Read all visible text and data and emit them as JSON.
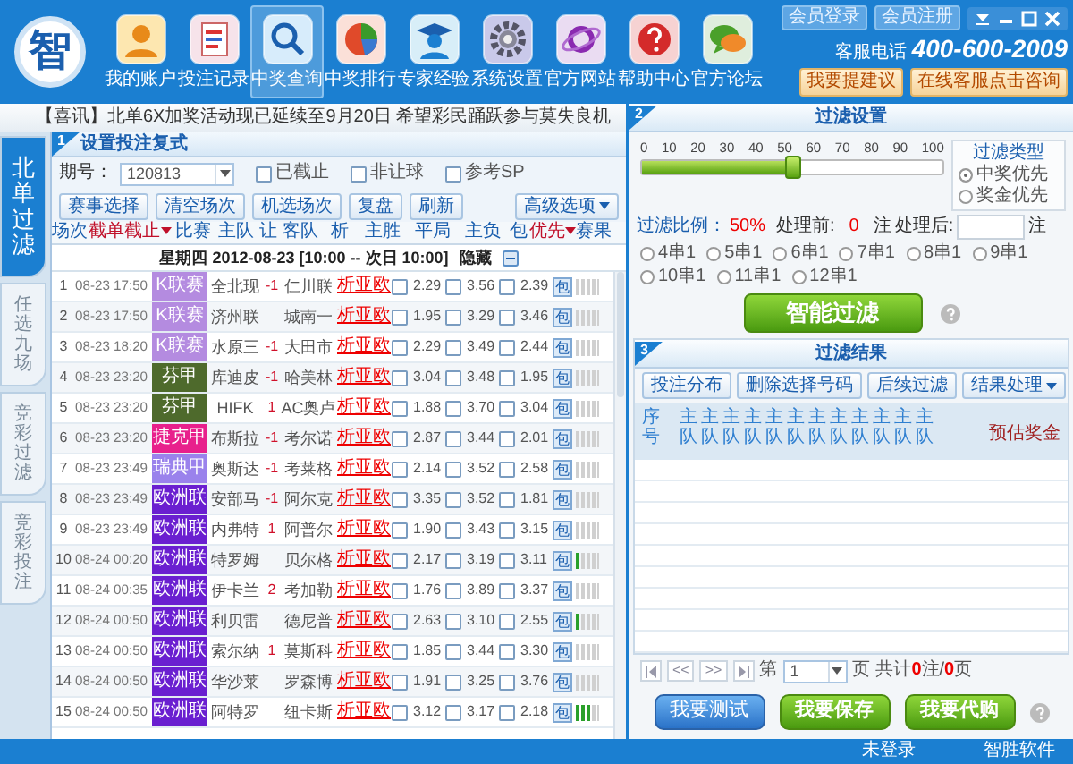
{
  "header": {
    "logo": "智",
    "nav": [
      {
        "label": "我的账户",
        "selected": false
      },
      {
        "label": "投注记录",
        "selected": false
      },
      {
        "label": "中奖查询",
        "selected": true
      },
      {
        "label": "中奖排行",
        "selected": false
      },
      {
        "label": "专家经验",
        "selected": false
      },
      {
        "label": "系统设置",
        "selected": false
      },
      {
        "label": "官方网站",
        "selected": false
      },
      {
        "label": "帮助中心",
        "selected": false
      },
      {
        "label": "官方论坛",
        "selected": false
      }
    ],
    "member_buttons": [
      "会员登录",
      "会员注册"
    ],
    "hotline_label": "客服电话",
    "hotline": "400-600-2009",
    "action_buttons": [
      "我要提建议",
      "在线客服点击咨询"
    ]
  },
  "ticker": "【喜讯】北单6X加奖活动现已延续至9月20日  希望彩民踊跃参与莫失良机",
  "side_tabs": [
    {
      "label": "北单过滤",
      "selected": true
    },
    {
      "label": "任选九场",
      "selected": false
    },
    {
      "label": "竞彩过滤",
      "selected": false
    },
    {
      "label": "竞彩投注",
      "selected": false
    }
  ],
  "bet_panel": {
    "step": "1",
    "title": "设置投注复式",
    "issue_label": "期号：",
    "issue": "120813",
    "checks": [
      {
        "label": "已截止",
        "checked": false
      },
      {
        "label": "非让球",
        "checked": false
      },
      {
        "label": "参考SP",
        "checked": false
      }
    ],
    "buttons": [
      "赛事选择",
      "清空场次",
      "机选场次",
      "复盘",
      "刷新"
    ],
    "advanced": "高级选项",
    "columns": [
      {
        "label": "场次",
        "sortable": false
      },
      {
        "label": "截单截止",
        "sortable": true
      },
      {
        "label": "比赛",
        "sortable": false
      },
      {
        "label": "主队",
        "sortable": false
      },
      {
        "label": "让",
        "sortable": false
      },
      {
        "label": "客队",
        "sortable": false
      },
      {
        "label": "析",
        "sortable": false
      },
      {
        "label": "主胜",
        "sortable": false
      },
      {
        "label": "平局",
        "sortable": false
      },
      {
        "label": "主负",
        "sortable": false
      },
      {
        "label": "包",
        "sortable": false
      },
      {
        "label": "优先",
        "sortable": true
      },
      {
        "label": "赛果",
        "sortable": false
      }
    ],
    "date_row": {
      "text": "星期四 2012-08-23 [10:00 -- 次日 10:00]",
      "hide": "隐藏"
    },
    "rows": [
      {
        "no": "1",
        "time": "08-23 17:50",
        "league": "K联赛",
        "color": "#b48be0",
        "home": "全北现",
        "handicap": "-1",
        "away": "仁川联",
        "analysis": "析亚欧",
        "odds": [
          "2.29",
          "3.56",
          "2.39"
        ],
        "picks": [
          false,
          false,
          false
        ],
        "pack": "包",
        "level": 0
      },
      {
        "no": "2",
        "time": "08-23 17:50",
        "league": "K联赛",
        "color": "#b48be0",
        "home": "济州联",
        "away": "城南一",
        "analysis": "析亚欧",
        "odds": [
          "1.95",
          "3.29",
          "3.46"
        ],
        "picks": [
          false,
          false,
          false
        ],
        "pack": "包",
        "level": 0
      },
      {
        "no": "3",
        "time": "08-23 18:20",
        "league": "K联赛",
        "color": "#b48be0",
        "home": "水原三",
        "handicap": "-1",
        "away": "大田市",
        "analysis": "析亚欧",
        "odds": [
          "2.29",
          "3.49",
          "2.44"
        ],
        "picks": [
          false,
          false,
          false
        ],
        "pack": "包",
        "level": 0
      },
      {
        "no": "4",
        "time": "08-23 23:20",
        "league": "芬甲",
        "color": "#4e6a2c",
        "home": "库迪皮",
        "handicap": "-1",
        "away": "哈美林",
        "analysis": "析亚欧",
        "odds": [
          "3.04",
          "3.48",
          "1.95"
        ],
        "picks": [
          false,
          false,
          false
        ],
        "pack": "包",
        "level": 0
      },
      {
        "no": "5",
        "time": "08-23 23:20",
        "league": "芬甲",
        "color": "#4e6a2c",
        "home": "HIFK",
        "handicap": "1",
        "away": "AC奥卢",
        "analysis": "析亚欧",
        "odds": [
          "1.88",
          "3.70",
          "3.04"
        ],
        "picks": [
          false,
          false,
          false
        ],
        "pack": "包",
        "level": 0
      },
      {
        "no": "6",
        "time": "08-23 23:20",
        "league": "捷克甲",
        "color": "#e8208c",
        "home": "布斯拉",
        "handicap": "-1",
        "away": "考尔诺",
        "analysis": "析亚欧",
        "odds": [
          "2.87",
          "3.44",
          "2.01"
        ],
        "picks": [
          false,
          false,
          false
        ],
        "pack": "包",
        "level": 0
      },
      {
        "no": "7",
        "time": "08-23 23:49",
        "league": "瑞典甲",
        "color": "#9a82ec",
        "home": "奥斯达",
        "handicap": "-1",
        "away": "考莱格",
        "analysis": "析亚欧",
        "odds": [
          "2.14",
          "3.52",
          "2.58"
        ],
        "picks": [
          false,
          false,
          false
        ],
        "pack": "包",
        "level": 0
      },
      {
        "no": "8",
        "time": "08-23 23:49",
        "league": "欧洲联",
        "color": "#6a1fd0",
        "home": "安部马",
        "handicap": "-1",
        "away": "阿尔克",
        "analysis": "析亚欧",
        "odds": [
          "3.35",
          "3.52",
          "1.81"
        ],
        "picks": [
          false,
          false,
          false
        ],
        "pack": "包",
        "level": 0
      },
      {
        "no": "9",
        "time": "08-23 23:49",
        "league": "欧洲联",
        "color": "#6a1fd0",
        "home": "内弗特",
        "handicap": "1",
        "away": "阿普尔",
        "analysis": "析亚欧",
        "odds": [
          "1.90",
          "3.43",
          "3.15"
        ],
        "picks": [
          false,
          false,
          false
        ],
        "pack": "包",
        "level": 0
      },
      {
        "no": "10",
        "time": "08-24 00:20",
        "league": "欧洲联",
        "color": "#6a1fd0",
        "home": "特罗姆",
        "away": "贝尔格",
        "analysis": "析亚欧",
        "odds": [
          "2.17",
          "3.19",
          "3.11"
        ],
        "picks": [
          false,
          false,
          false
        ],
        "pack": "包",
        "level": 0.2
      },
      {
        "no": "11",
        "time": "08-24 00:35",
        "league": "欧洲联",
        "color": "#6a1fd0",
        "home": "伊卡兰",
        "handicap": "2",
        "away": "考加勒",
        "analysis": "析亚欧",
        "odds": [
          "1.76",
          "3.89",
          "3.37"
        ],
        "picks": [
          false,
          false,
          false
        ],
        "pack": "包",
        "level": 0
      },
      {
        "no": "12",
        "time": "08-24 00:50",
        "league": "欧洲联",
        "color": "#6a1fd0",
        "home": "利贝雷",
        "away": "德尼普",
        "analysis": "析亚欧",
        "odds": [
          "2.63",
          "3.10",
          "2.55"
        ],
        "picks": [
          false,
          false,
          false
        ],
        "pack": "包",
        "level": 0.2
      },
      {
        "no": "13",
        "time": "08-24 00:50",
        "league": "欧洲联",
        "color": "#6a1fd0",
        "home": "索尔纳",
        "handicap": "1",
        "away": "莫斯科",
        "analysis": "析亚欧",
        "odds": [
          "1.85",
          "3.44",
          "3.30"
        ],
        "picks": [
          false,
          false,
          false
        ],
        "pack": "包",
        "level": 0
      },
      {
        "no": "14",
        "time": "08-24 00:50",
        "league": "欧洲联",
        "color": "#6a1fd0",
        "home": "华沙莱",
        "away": "罗森博",
        "analysis": "析亚欧",
        "odds": [
          "1.91",
          "3.25",
          "3.76"
        ],
        "picks": [
          false,
          false,
          false
        ],
        "pack": "包",
        "level": 0
      },
      {
        "no": "15",
        "time": "08-24 00:50",
        "league": "欧洲联",
        "color": "#6a1fd0",
        "home": "阿特罗",
        "away": "纽卡斯",
        "analysis": "析亚欧",
        "odds": [
          "3.12",
          "3.17",
          "2.18"
        ],
        "picks": [
          false,
          false,
          false
        ],
        "pack": "包",
        "level": 0.6
      }
    ]
  },
  "filter_panel": {
    "step": "2",
    "title": "过滤设置",
    "scale": [
      "0",
      "10",
      "20",
      "30",
      "40",
      "50",
      "60",
      "70",
      "80",
      "90",
      "100"
    ],
    "level": 0.5,
    "type_title": "过滤类型",
    "types": [
      {
        "label": "中奖优先",
        "selected": true
      },
      {
        "label": "奖金优先",
        "selected": false
      }
    ],
    "ratio_label": "过滤比例：",
    "ratio": "50%",
    "before_label": "处理前:",
    "before": "0",
    "before_unit": "注",
    "after_label": "处理后:",
    "after_unit": "注",
    "combos": [
      {
        "label": "4串1",
        "selected": false
      },
      {
        "label": "5串1",
        "selected": false
      },
      {
        "label": "6串1",
        "selected": false
      },
      {
        "label": "7串1",
        "selected": false
      },
      {
        "label": "8串1",
        "selected": false
      },
      {
        "label": "9串1",
        "selected": false
      },
      {
        "label": "10串1",
        "selected": false
      },
      {
        "label": "11串1",
        "selected": false
      },
      {
        "label": "12串1",
        "selected": false
      }
    ],
    "smart_button": "智能过滤"
  },
  "results": {
    "step": "3",
    "title": "过滤结果",
    "buttons": [
      "投注分布",
      "删除选择号码",
      "后续过滤"
    ],
    "menu": "结果处理",
    "columns": [
      "序号",
      "主队",
      "主队",
      "主队",
      "主队",
      "主队",
      "主队",
      "主队",
      "主队",
      "主队",
      "主队",
      "主队",
      "主队"
    ],
    "prize_column": "预估奖金",
    "pager": {
      "prev": "<<",
      "next": ">>",
      "page_label": "第",
      "page": "1",
      "page_unit": "页",
      "summary": [
        "共计",
        "0",
        "注/",
        "0",
        "页"
      ]
    },
    "actions": [
      {
        "label": "我要测试",
        "kind": "blue"
      },
      {
        "label": "我要保存",
        "kind": "green"
      },
      {
        "label": "我要代购",
        "kind": "green"
      }
    ]
  },
  "status_bar": [
    "未登录",
    "智胜软件"
  ]
}
